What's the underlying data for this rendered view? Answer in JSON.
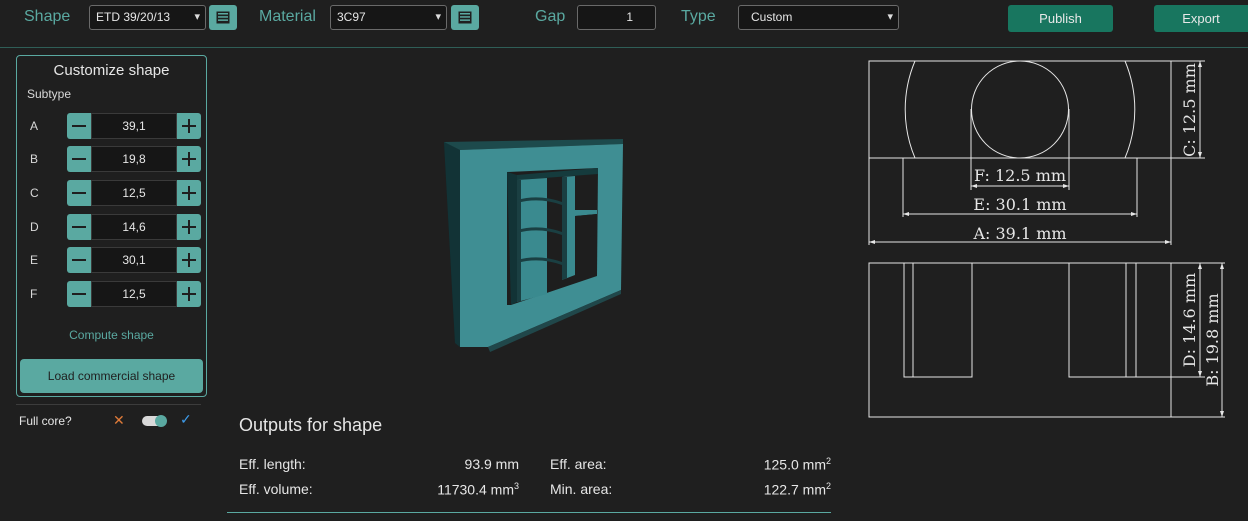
{
  "toolbar": {
    "shape_label": "Shape",
    "shape_value": "ETD 39/20/13",
    "material_label": "Material",
    "material_value": "3C97",
    "gap_label": "Gap",
    "gap_value": "1",
    "type_label": "Type",
    "type_value": "Custom",
    "publish_label": "Publish",
    "export_label": "Export"
  },
  "customize": {
    "title": "Customize shape",
    "subtype_label": "Subtype",
    "params": [
      {
        "name": "A",
        "value": "39,1"
      },
      {
        "name": "B",
        "value": "19,8"
      },
      {
        "name": "C",
        "value": "12,5"
      },
      {
        "name": "D",
        "value": "14,6"
      },
      {
        "name": "E",
        "value": "30,1"
      },
      {
        "name": "F",
        "value": "12,5"
      }
    ],
    "compute_label": "Compute shape",
    "load_label": "Load commercial shape"
  },
  "full_core": {
    "label": "Full core?",
    "off_symbol": "✕",
    "on_symbol": "✓",
    "enabled": true
  },
  "outputs": {
    "title": "Outputs for shape",
    "eff_length_label": "Eff. length:",
    "eff_length_value": "93.9 mm",
    "eff_volume_label": "Eff. volume:",
    "eff_volume_value": "11730.4 mm",
    "eff_volume_unit_sup": "3",
    "eff_area_label": "Eff. area:",
    "eff_area_value": "125.0 mm",
    "eff_area_unit_sup": "2",
    "min_area_label": "Min. area:",
    "min_area_value": "122.7 mm",
    "min_area_unit_sup": "2"
  },
  "drawing": {
    "dim_c": "C: 12.5 mm",
    "dim_f": "F: 12.5 mm",
    "dim_e": "E: 30.1 mm",
    "dim_a": "A: 39.1 mm",
    "dim_d": "D: 14.6 mm",
    "dim_b": "B: 19.8 mm"
  },
  "colors": {
    "accent": "#5aa9a1",
    "button_green": "#18765f",
    "background": "#1f1f1f",
    "cross": "#e07b39",
    "check": "#3d9be9"
  },
  "icons": {
    "shape_table_button": "table-icon",
    "material_table_button": "table-icon",
    "minus": "minus-icon",
    "plus": "plus-icon"
  }
}
